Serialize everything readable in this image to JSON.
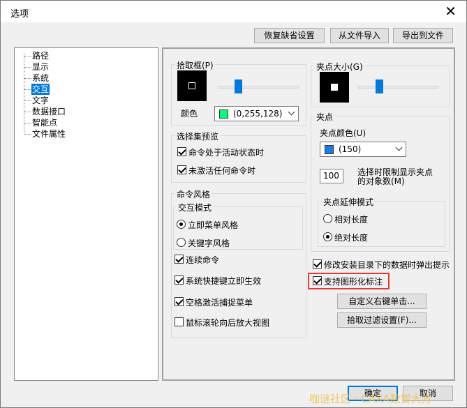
{
  "window": {
    "title": "选项",
    "close_glyph": "✕"
  },
  "top_buttons": {
    "restore": "恢复缺省设置",
    "import": "从文件导入",
    "export": "导出到文件"
  },
  "tree": {
    "items": [
      "路径",
      "显示",
      "系统",
      "交互",
      "文字",
      "数据接口",
      "智能点",
      "文件属性"
    ],
    "selected": "交互"
  },
  "pickbox": {
    "title": "拾取框(P)",
    "color_label": "颜色",
    "color_value": "(0,255,128)",
    "swatch_color": "#00ff80"
  },
  "selection_preview": {
    "title": "选择集预览",
    "cb1": "命令处于活动状态时",
    "cb1_checked": true,
    "cb2": "未激活任何命令时",
    "cb2_checked": true
  },
  "command_style": {
    "title": "命令风格",
    "interaction_mode": {
      "title": "交互模式",
      "opt1": "立即菜单风格",
      "opt2": "关键字风格",
      "selected": 1
    },
    "cb_continuous": "连续命令",
    "cb_continuous_checked": true,
    "cb_shortcut": "系统快捷键立即生效",
    "cb_shortcut_checked": true,
    "cb_space": "空格激活捕捉菜单",
    "cb_space_checked": true,
    "cb_wheel": "鼠标滚轮向后放大视图",
    "cb_wheel_checked": false
  },
  "grip_size": {
    "title": "夹点大小(G)"
  },
  "grip": {
    "title": "夹点",
    "color_label": "夹点颜色(U)",
    "color_value": "(150)",
    "swatch_color": "#1e7be0",
    "limit_value": "100",
    "limit_label_1": "选择时限制显示夹点",
    "limit_label_2": "的对象数(M)",
    "stretch": {
      "title": "夹点延伸模式",
      "opt1": "相对长度",
      "opt2": "绝对长度",
      "selected": 2
    }
  },
  "cb_modify_prompt": "修改安装目录下的数据时弹出提示",
  "cb_modify_prompt_checked": true,
  "cb_graphic_note": "支持图形化标注",
  "cb_graphic_note_checked": true,
  "btn_custom_right_click": "自定义右键单击...",
  "btn_pick_filter": "拾取过滤设置(F)...",
  "footer": {
    "ok": "确定",
    "cancel": "取消"
  },
  "watermark": "咖谜社区 · CAXA数智大方"
}
